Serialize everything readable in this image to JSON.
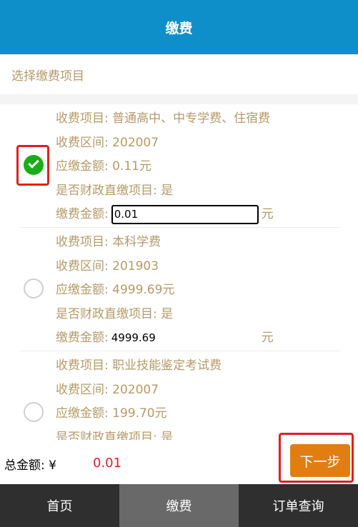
{
  "header": {
    "title": "缴费"
  },
  "section": {
    "title": "选择缴费项目"
  },
  "items": [
    {
      "checked": true,
      "name_line": "收费项目: 普通高中、中专学费、住宿费",
      "period_line": "收费区间: 202007",
      "due_line": "应缴金额: 0.11元",
      "fiscal_line": "是否财政直缴项目: 是",
      "amount_label": "缴费金额:",
      "amount_value": "0.01",
      "unit": "元"
    },
    {
      "checked": false,
      "name_line": "收费项目: 本科学费",
      "period_line": "收费区间: 201903",
      "due_line": "应缴金额: 4999.69元",
      "fiscal_line": "是否财政直缴项目: 是",
      "amount_label": "缴费金额:",
      "amount_value": "4999.69",
      "unit": "元"
    },
    {
      "checked": false,
      "name_line": "收费项目: 职业技能鉴定考试费",
      "period_line": "收费区间: 202007",
      "due_line": "应缴金额: 199.70元",
      "fiscal_line": "是否财政直缴项目: 是"
    }
  ],
  "footer": {
    "total_label": "总金额: ¥",
    "total_value": "0.01",
    "next_label": "下一步"
  },
  "tabbar": {
    "tabs": [
      {
        "label": "首页",
        "active": false
      },
      {
        "label": "缴费",
        "active": true
      },
      {
        "label": "订单查询",
        "active": false
      }
    ]
  },
  "colors": {
    "header_bg": "#0e8fca",
    "label_text": "#b59a6a",
    "check_green": "#1aad19",
    "accent_orange": "#e27d12",
    "total_red": "#e0201f",
    "highlight_red": "#e0201f",
    "tabbar_bg": "#2f2f2f",
    "tab_active_bg": "#696969"
  }
}
